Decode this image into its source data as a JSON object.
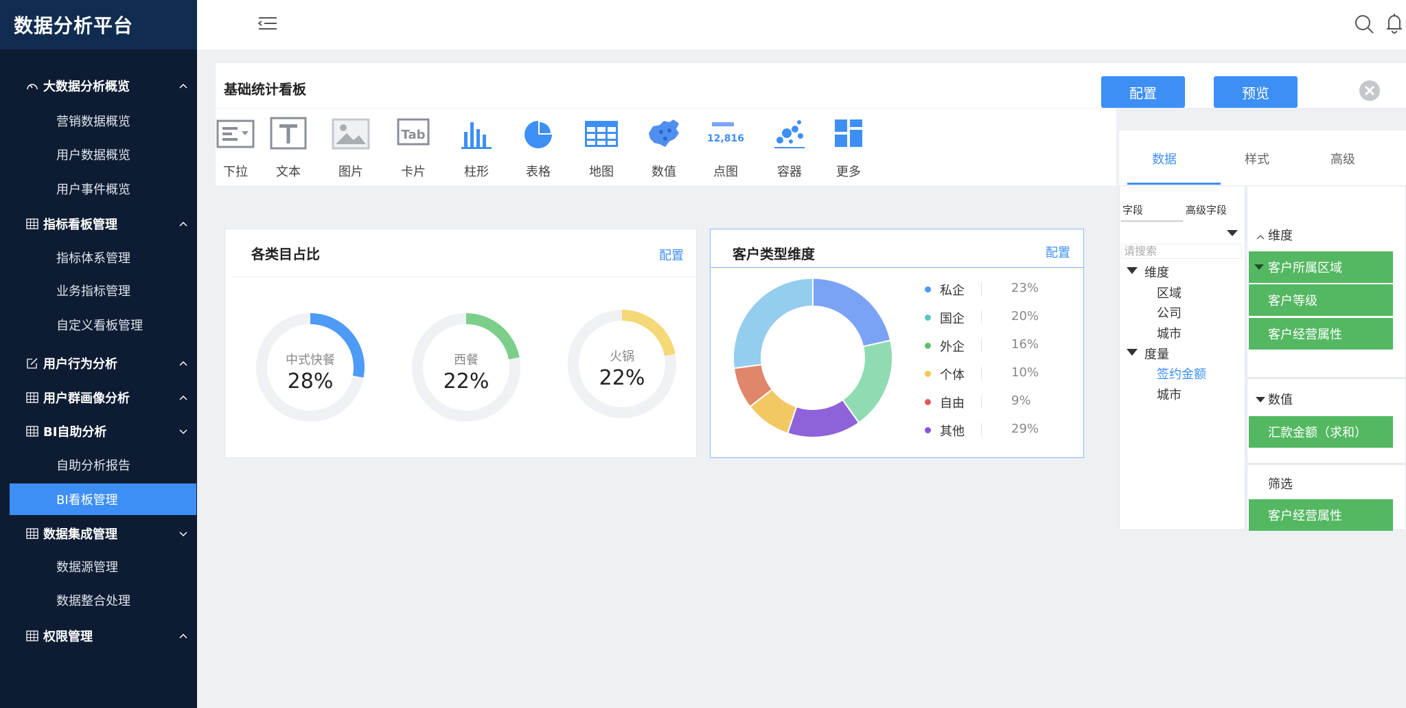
{
  "app": {
    "title": "数据分析平台"
  },
  "sidebar": {
    "groups": [
      {
        "label": "大数据分析概览",
        "icon": "gauge-icon",
        "expanded": true
      },
      {
        "label": "指标看板管理",
        "icon": "table-icon",
        "expanded": true
      },
      {
        "label": "用户行为分析",
        "icon": "edit-icon",
        "expanded": true
      },
      {
        "label": "用户群画像分析",
        "icon": "table-icon",
        "expanded": true
      },
      {
        "label": "BI自助分析",
        "icon": "table-icon",
        "expanded": false
      },
      {
        "label": "数据集成管理",
        "icon": "table-icon",
        "expanded": false
      },
      {
        "label": "权限管理",
        "icon": "table-icon",
        "expanded": true
      }
    ],
    "items": [
      "营销数据概览",
      "用户数据概览",
      "用户事件概览",
      "指标体系管理",
      "业务指标管理",
      "自定义看板管理",
      "自助分析报告",
      "BI看板管理",
      "数据源管理",
      "数据整合处理"
    ],
    "active_item": "BI看板管理"
  },
  "topbar": {
    "icons": [
      "menu-fold-icon",
      "search-icon",
      "bell-icon"
    ]
  },
  "panel": {
    "title": "基础统计看板",
    "config_button": "配置",
    "preview_button": "预览",
    "toolbar": [
      {
        "label": "下拉",
        "icon": "dropdown-widget-icon"
      },
      {
        "label": "文本",
        "icon": "text-widget-icon"
      },
      {
        "label": "图片",
        "icon": "image-widget-icon"
      },
      {
        "label": "卡片",
        "icon": "card-widget-icon"
      },
      {
        "label": "柱形",
        "icon": "bar-chart-icon"
      },
      {
        "label": "表格",
        "icon": "pie-chart-icon"
      },
      {
        "label": "地图",
        "icon": "table-grid-icon"
      },
      {
        "label": "数值",
        "icon": "map-icon"
      },
      {
        "label": "点图",
        "icon": "number-widget-icon",
        "icon_text": "12,816"
      },
      {
        "label": "容器",
        "icon": "scatter-icon"
      },
      {
        "label": "更多",
        "icon": "more-widgets-icon"
      }
    ]
  },
  "cards": {
    "category": {
      "title": "各类目占比",
      "link": "配置",
      "gauges": [
        {
          "label": "中式快餐",
          "value_text": "28%",
          "fraction": 0.28,
          "color": "#4e9bf7"
        },
        {
          "label": "西餐",
          "value_text": "22%",
          "fraction": 0.22,
          "color": "#7ccf8a"
        },
        {
          "label": "火锅",
          "value_text": "22%",
          "fraction": 0.22,
          "color": "#f5d878"
        }
      ]
    },
    "customer": {
      "title": "客户类型维度",
      "link": "配置"
    }
  },
  "chart_data": {
    "type": "pie",
    "donut": true,
    "categories": [
      "私企",
      "国企",
      "外企",
      "个体",
      "自由",
      "其他"
    ],
    "values": [
      23,
      20,
      16,
      10,
      9,
      29
    ],
    "value_labels": [
      "23%",
      "20%",
      "16%",
      "10%",
      "9%",
      "29%"
    ],
    "legend_colors": [
      "#4e9bf7",
      "#5cc6c2",
      "#5cbf6a",
      "#f3c84c",
      "#e05a5a",
      "#8a55dc"
    ],
    "slice_colors": [
      "#7aa2f5",
      "#8fdcb2",
      "#8f62d9",
      "#f2c862",
      "#e0866b",
      "#94cdee"
    ],
    "legend": "right"
  },
  "config_panel": {
    "tabs": [
      "数据",
      "样式",
      "高级"
    ],
    "active_tab": "数据",
    "field_tabs": [
      "字段",
      "高级字段"
    ],
    "search_placeholder": "请搜索",
    "tree": {
      "dimension_label": "维度",
      "dimension_items": [
        "区域",
        "公司",
        "城市"
      ],
      "measure_label": "度量",
      "measure_items": [
        "签约金额",
        "城市"
      ],
      "selected": "签约金额"
    },
    "dimension_slot": {
      "label": "维度",
      "chips": [
        "客户所属区域",
        "客户等级",
        "客户经营属性"
      ]
    },
    "value_slot": {
      "label": "数值",
      "chips": [
        "汇款金额（求和）"
      ]
    },
    "filter_slot": {
      "label": "筛选",
      "chips": [
        "客户经营属性"
      ]
    }
  },
  "colors": {
    "accent": "#3d8ff6",
    "sidebar_bg": "#0e1c33",
    "brand_bg": "#102c50",
    "chip_green": "#54b862"
  }
}
